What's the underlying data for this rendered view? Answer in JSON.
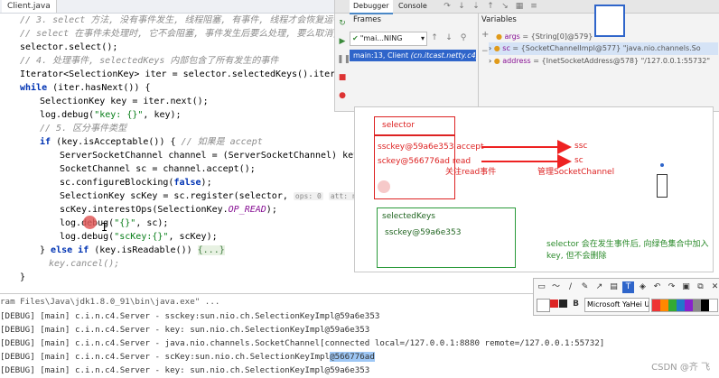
{
  "editor": {
    "tab_label": "Client.java",
    "lines": {
      "l1": "// 3. select 方法, 没有事件发生, 线程阻塞, 有事件, 线程才会恢复运行",
      "l2": "// select 在事件未处理时, 它不会阻塞, 事件发生后要么处理, 要么取消, 不",
      "l3": "selector.select();",
      "l4": "// 4. 处理事件, selectedKeys 内部包含了所有发生的事件",
      "l5": "Iterator<SelectionKey> iter = selector.selectedKeys().iterator",
      "l6_kw": "while",
      "l6_rest": " (iter.hasNext()) {",
      "l7": "SelectionKey key = iter.next();",
      "l8_a": "log.debug(",
      "l8_str": "\"key: {}\"",
      "l8_b": ", key);",
      "l9": "// 5. 区分事件类型",
      "l10_kw": "if",
      "l10_rest": " (key.isAcceptable()) { ",
      "l10_cm": "// 如果是 accept",
      "l11": "ServerSocketChannel channel = (ServerSocketChannel) key.chann",
      "l12": "SocketChannel sc = channel.accept();",
      "l13_a": "sc.configureBlocking(",
      "l13_kw": "false",
      "l13_b": ");",
      "l14_a": "SelectionKey scKey = sc.register(selector, ",
      "l14_hint1": "ops: 0",
      "l14_hint2": "att: null",
      "l14_b": ");",
      "l15_a": "scKey.interestOps(SelectionKey.",
      "l15_const": "OP_READ",
      "l15_b": ");",
      "l16_a": "log.debug(",
      "l16_str": "\"{}\"",
      "l16_b": ", sc);",
      "l17_a": "log.debug(",
      "l17_str": "\"scKey:{}\"",
      "l17_b": ", scKey);",
      "l18_a": "} ",
      "l18_kw1": "else",
      "l18_kw2": "if",
      "l18_b": " (key.isReadable()) ",
      "l18_fold": "{...}",
      "l19": "key.cancel();",
      "l20": "}"
    }
  },
  "debugger": {
    "tabs": [
      "Debugger",
      "Console"
    ],
    "frames_title": "Frames",
    "variables_title": "Variables",
    "thread_select": "\"mai...NING",
    "frame_item": "main:13, Client",
    "frame_item_file": "(cn.itcast.netty.c4)",
    "variables": [
      {
        "name": "args",
        "value": "= {String[0]@579}"
      },
      {
        "name": "sc",
        "value": "= {SocketChannelImpl@577} \"java.nio.channels.So"
      },
      {
        "name": "address",
        "value": "= {InetSocketAddress@578} \"/127.0.0.1:55732\""
      }
    ]
  },
  "diagram": {
    "selector_label": "selector",
    "sskey_row": "ssckey@59a6e353 accept",
    "sckey_row": "sckey@566776ad read",
    "note_read": "关注read事件",
    "arrow1_target": "ssc",
    "arrow2_target": "sc",
    "manage_label": "管理SocketChannel",
    "selectedkeys_label": "selectedKeys",
    "selectedkeys_item": "ssckey@59a6e353",
    "explain": "selector 会在发生事件后, 向绿色集合中加入key, 但不会删除"
  },
  "console": {
    "lines": [
      "ram Files\\Java\\jdk1.8.0_91\\bin\\java.exe\" ...",
      "[DEBUG] [main] c.i.n.c4.Server - ssckey:sun.nio.ch.SelectionKeyImpl@59a6e353",
      "[DEBUG] [main] c.i.n.c4.Server - key: sun.nio.ch.SelectionKeyImpl@59a6e353",
      "[DEBUG] [main] c.i.n.c4.Server - java.nio.channels.SocketChannel[connected local=/127.0.0.1:8880 remote=/127.0.0.1:55732]"
    ],
    "line5_prefix": "[DEBUG] [main] c.i.n.c4.Server - scKey:sun.nio.ch.SelectionKeyImpl",
    "line5_selected": "@566776ad",
    "line6": "[DEBUG] [main] c.i.n.c4.Server - key: sun.nio.ch.SelectionKeyImpl@59a6e353"
  },
  "draw_toolbar": {
    "font_select": "Microsoft YaHei U"
  },
  "watermark": "CSDN @齐 飞",
  "colors": {
    "red": "#dd2222",
    "green": "#2a9a3a",
    "selection": "#9ec7f5"
  }
}
